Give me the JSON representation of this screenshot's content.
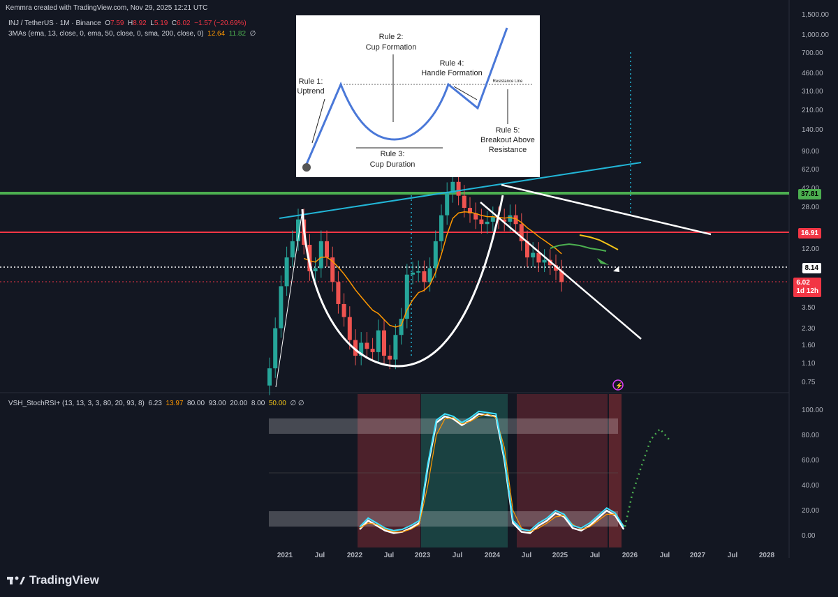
{
  "header": {
    "credit": "Kemmra created with TradingView.com, Nov 29, 2025 12:21 UTC"
  },
  "symbol": {
    "name": "INJ / TetherUS · 1M · Binance",
    "o_label": "O",
    "o": "7.59",
    "h_label": "H",
    "h": "8.92",
    "l_label": "L",
    "l": "5.19",
    "c_label": "C",
    "c": "6.02",
    "change": "−1.57 (−20.69%)"
  },
  "ma": {
    "label": "3MAs (ema, 13, close, 0, ema, 50, close, 0, sma, 200, close, 0)",
    "v1": "12.64",
    "v2": "11.82",
    "v3": "∅"
  },
  "stoch": {
    "label": "VSH_StochRSI+ (13, 13, 3, 3, 80, 20, 93, 8)",
    "v1": "6.23",
    "v2": "13.97",
    "v3": "80.00",
    "v4": "93.00",
    "v5": "20.00",
    "v6": "8.00",
    "v7": "50.00",
    "v8": "∅ ∅"
  },
  "price_tags": {
    "green": "37.81",
    "red": "16.91",
    "last": "8.14",
    "current": "6.02",
    "countdown": "1d 12h"
  },
  "colors": {
    "up": "#26a69a",
    "down": "#ef5350",
    "green_line": "#4caf50",
    "red_line": "#f23645",
    "cyan": "#22b5d6",
    "ema": "#ff9800"
  },
  "inset": {
    "rule1": "Rule 1:",
    "rule1b": "Uptrend",
    "rule2": "Rule 2:",
    "rule2b": "Cup Formation",
    "rule3": "Rule 3:",
    "rule3b": "Cup Duration",
    "rule4": "Rule 4:",
    "rule4b": "Handle Formation",
    "rule5": "Rule 5:",
    "rule5b": "Breakout Above",
    "rule5c": "Resistance",
    "resistance": "Resistance Line"
  },
  "footer": {
    "brand": "TradingView"
  },
  "chart_data": [
    {
      "type": "candlestick",
      "title": "INJ / TetherUS · 1M · Binance",
      "scale": "log",
      "y_ticks": [
        "1,500.00",
        "1,000.00",
        "700.00",
        "460.00",
        "310.00",
        "210.00",
        "140.00",
        "90.00",
        "62.00",
        "42.00",
        "28.00",
        "12.00",
        "5.60",
        "3.50",
        "2.30",
        "1.60",
        "1.10",
        "0.75"
      ],
      "x_ticks": [
        "2021",
        "Jul",
        "2022",
        "Jul",
        "2023",
        "Jul",
        "2024",
        "Jul",
        "2025",
        "Jul",
        "2026",
        "Jul",
        "2027",
        "Jul",
        "2028"
      ],
      "horizontal_levels": [
        37.81,
        16.91,
        8.14,
        6.02
      ],
      "approx_monthly_close": [
        1.0,
        2.3,
        5.5,
        10,
        14,
        22,
        13,
        7.5,
        8,
        14,
        10,
        6,
        3.8,
        2.9,
        1.8,
        1.3,
        1.7,
        1.5,
        1.4,
        2.2,
        1.3,
        1.2,
        2.0,
        2.8,
        7.0,
        7.3,
        7.5,
        6.0,
        8.0,
        14,
        24,
        38,
        48,
        36,
        28,
        25,
        22,
        20,
        21,
        23,
        22,
        21,
        24,
        20,
        14,
        10,
        11,
        9,
        9.5,
        8.5,
        7.6,
        6.0
      ]
    },
    {
      "type": "line",
      "title": "VSH_StochRSI+ (13, 13, 3, 3, 80, 20, 93, 8)",
      "y_ticks": [
        "100.00",
        "80.00",
        "60.00",
        "40.00",
        "20.00",
        "0.00"
      ],
      "ylim": [
        0,
        100
      ],
      "bands": [
        [
          80,
          93
        ],
        [
          8,
          20
        ]
      ],
      "series": [
        {
          "name": "K",
          "values": [
            5,
            12,
            8,
            4,
            2,
            3,
            6,
            10,
            55,
            90,
            95,
            93,
            88,
            92,
            97,
            96,
            95,
            60,
            10,
            3,
            2,
            8,
            12,
            18,
            15,
            6,
            4,
            8,
            14,
            20,
            16,
            5
          ]
        },
        {
          "name": "D",
          "values": [
            6,
            10,
            9,
            5,
            3,
            3,
            5,
            9,
            40,
            80,
            93,
            94,
            89,
            91,
            95,
            97,
            94,
            70,
            20,
            6,
            3,
            6,
            10,
            15,
            16,
            9,
            5,
            7,
            12,
            17,
            17,
            8
          ]
        }
      ]
    }
  ]
}
